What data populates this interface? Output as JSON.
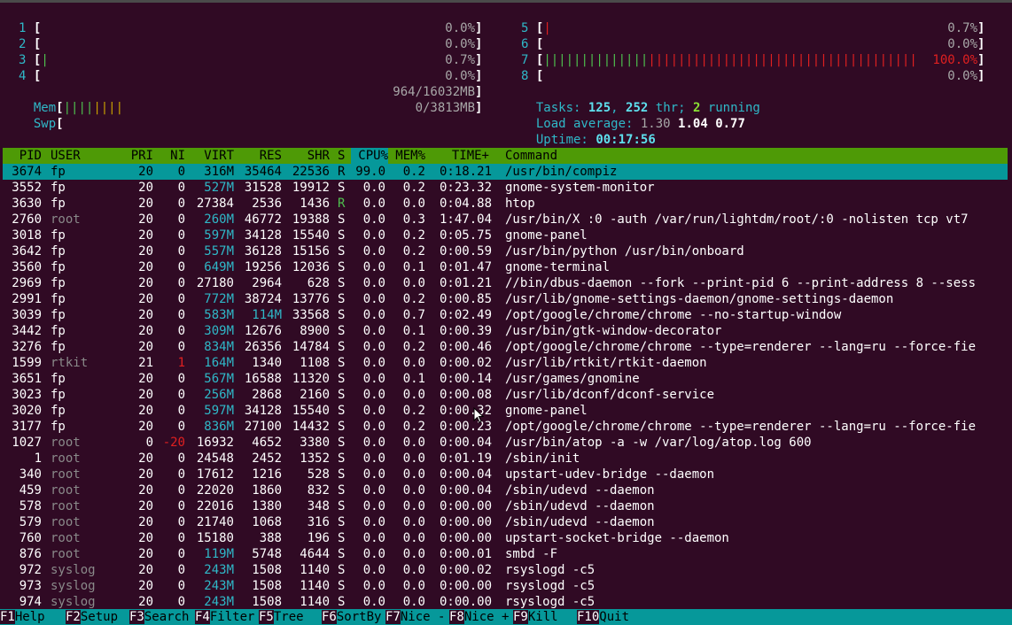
{
  "cpu_meters_left": [
    {
      "label": "1",
      "bars": "",
      "bar_color": "green",
      "value": "0.0%"
    },
    {
      "label": "2",
      "bars": "",
      "bar_color": "green",
      "value": "0.0%"
    },
    {
      "label": "3",
      "bars": "|",
      "bar_color": "green",
      "value": "0.7%"
    },
    {
      "label": "4",
      "bars": "",
      "bar_color": "green",
      "value": "0.0%"
    }
  ],
  "cpu_meters_right": [
    {
      "label": "5",
      "bars": "|",
      "bar_color": "red",
      "value": "0.7%"
    },
    {
      "label": "6",
      "bars": "",
      "bar_color": "green",
      "value": "0.0%"
    },
    {
      "label": "7",
      "bars_green": "||||||||||||||",
      "bars_red": "||||||||||||||||||||||||||||||||||||",
      "value": "100.0%"
    },
    {
      "label": "8",
      "bars": "",
      "bar_color": "green",
      "value": "0.0%"
    }
  ],
  "mem": {
    "label": "Mem",
    "bars_green": "||||",
    "bars_yellow": "||||",
    "value": "964/16032MB"
  },
  "swp": {
    "label": "Swp",
    "bars": "",
    "value": "0/3813MB"
  },
  "tasks": {
    "label": "Tasks:",
    "tasks": "125",
    "sep": ",",
    "threads": "252",
    "thr_label": "thr;",
    "running": "2",
    "running_label": "running"
  },
  "load": {
    "label": "Load average:",
    "l1": "1.30",
    "l5": "1.04",
    "l15": "0.77"
  },
  "uptime": {
    "label": "Uptime:",
    "value": "00:17:56"
  },
  "columns": [
    "PID",
    "USER",
    "PRI",
    "NI",
    "VIRT",
    "RES",
    "SHR",
    "S",
    "CPU%",
    "MEM%",
    "TIME+",
    "Command"
  ],
  "processes": [
    {
      "pid": "3674",
      "user": "fp",
      "pri": "20",
      "ni": "0",
      "virt": "316M",
      "res": "35464",
      "shr": "22536",
      "s": "R",
      "cpu": "99.0",
      "mem": "0.2",
      "time": "0:18.21",
      "cmd": "/usr/bin/compiz",
      "selected": true
    },
    {
      "pid": "3552",
      "user": "fp",
      "pri": "20",
      "ni": "0",
      "virt": "527M",
      "res": "31528",
      "shr": "19912",
      "s": "S",
      "cpu": "0.0",
      "mem": "0.2",
      "time": "0:23.32",
      "cmd": "gnome-system-monitor"
    },
    {
      "pid": "3630",
      "user": "fp",
      "pri": "20",
      "ni": "0",
      "virt": "27384",
      "res": "2536",
      "shr": "1436",
      "s": "R",
      "cpu": "0.0",
      "mem": "0.0",
      "time": "0:04.88",
      "cmd": "htop"
    },
    {
      "pid": "2760",
      "user": "root",
      "pri": "20",
      "ni": "0",
      "virt": "260M",
      "res": "46772",
      "shr": "19388",
      "s": "S",
      "cpu": "0.0",
      "mem": "0.3",
      "time": "1:47.04",
      "cmd": "/usr/bin/X :0 -auth /var/run/lightdm/root/:0 -nolisten tcp vt7"
    },
    {
      "pid": "3018",
      "user": "fp",
      "pri": "20",
      "ni": "0",
      "virt": "597M",
      "res": "34128",
      "shr": "15540",
      "s": "S",
      "cpu": "0.0",
      "mem": "0.2",
      "time": "0:05.75",
      "cmd": "gnome-panel"
    },
    {
      "pid": "3642",
      "user": "fp",
      "pri": "20",
      "ni": "0",
      "virt": "557M",
      "res": "36128",
      "shr": "15156",
      "s": "S",
      "cpu": "0.0",
      "mem": "0.2",
      "time": "0:00.59",
      "cmd": "/usr/bin/python /usr/bin/onboard"
    },
    {
      "pid": "3560",
      "user": "fp",
      "pri": "20",
      "ni": "0",
      "virt": "649M",
      "res": "19256",
      "shr": "12036",
      "s": "S",
      "cpu": "0.0",
      "mem": "0.1",
      "time": "0:01.47",
      "cmd": "gnome-terminal"
    },
    {
      "pid": "2969",
      "user": "fp",
      "pri": "20",
      "ni": "0",
      "virt": "27180",
      "res": "2964",
      "shr": "628",
      "s": "S",
      "cpu": "0.0",
      "mem": "0.0",
      "time": "0:01.21",
      "cmd": "//bin/dbus-daemon --fork --print-pid 6 --print-address 8 --sess"
    },
    {
      "pid": "2991",
      "user": "fp",
      "pri": "20",
      "ni": "0",
      "virt": "772M",
      "res": "38724",
      "shr": "13776",
      "s": "S",
      "cpu": "0.0",
      "mem": "0.2",
      "time": "0:00.85",
      "cmd": "/usr/lib/gnome-settings-daemon/gnome-settings-daemon"
    },
    {
      "pid": "3039",
      "user": "fp",
      "pri": "20",
      "ni": "0",
      "virt": "583M",
      "res": "114M",
      "shr": "33568",
      "s": "S",
      "cpu": "0.0",
      "mem": "0.7",
      "time": "0:02.49",
      "cmd": "/opt/google/chrome/chrome --no-startup-window"
    },
    {
      "pid": "3442",
      "user": "fp",
      "pri": "20",
      "ni": "0",
      "virt": "309M",
      "res": "12676",
      "shr": "8900",
      "s": "S",
      "cpu": "0.0",
      "mem": "0.1",
      "time": "0:00.39",
      "cmd": "/usr/bin/gtk-window-decorator"
    },
    {
      "pid": "3276",
      "user": "fp",
      "pri": "20",
      "ni": "0",
      "virt": "834M",
      "res": "26356",
      "shr": "14784",
      "s": "S",
      "cpu": "0.0",
      "mem": "0.2",
      "time": "0:00.46",
      "cmd": "/opt/google/chrome/chrome --type=renderer --lang=ru --force-fie"
    },
    {
      "pid": "1599",
      "user": "rtkit",
      "pri": "21",
      "ni": "1",
      "virt": "164M",
      "res": "1340",
      "shr": "1108",
      "s": "S",
      "cpu": "0.0",
      "mem": "0.0",
      "time": "0:00.02",
      "cmd": "/usr/lib/rtkit/rtkit-daemon"
    },
    {
      "pid": "3651",
      "user": "fp",
      "pri": "20",
      "ni": "0",
      "virt": "567M",
      "res": "16588",
      "shr": "11320",
      "s": "S",
      "cpu": "0.0",
      "mem": "0.1",
      "time": "0:00.14",
      "cmd": "/usr/games/gnomine"
    },
    {
      "pid": "3023",
      "user": "fp",
      "pri": "20",
      "ni": "0",
      "virt": "256M",
      "res": "2868",
      "shr": "2160",
      "s": "S",
      "cpu": "0.0",
      "mem": "0.0",
      "time": "0:00.08",
      "cmd": "/usr/lib/dconf/dconf-service"
    },
    {
      "pid": "3020",
      "user": "fp",
      "pri": "20",
      "ni": "0",
      "virt": "597M",
      "res": "34128",
      "shr": "15540",
      "s": "S",
      "cpu": "0.0",
      "mem": "0.2",
      "time": "0:00.32",
      "cmd": "gnome-panel"
    },
    {
      "pid": "3177",
      "user": "fp",
      "pri": "20",
      "ni": "0",
      "virt": "836M",
      "res": "27100",
      "shr": "14432",
      "s": "S",
      "cpu": "0.0",
      "mem": "0.2",
      "time": "0:00.23",
      "cmd": "/opt/google/chrome/chrome --type=renderer --lang=ru --force-fie"
    },
    {
      "pid": "1027",
      "user": "root",
      "pri": "0",
      "ni": "-20",
      "virt": "16932",
      "res": "4652",
      "shr": "3380",
      "s": "S",
      "cpu": "0.0",
      "mem": "0.0",
      "time": "0:00.04",
      "cmd": "/usr/bin/atop -a -w /var/log/atop.log 600"
    },
    {
      "pid": "1",
      "user": "root",
      "pri": "20",
      "ni": "0",
      "virt": "24548",
      "res": "2452",
      "shr": "1352",
      "s": "S",
      "cpu": "0.0",
      "mem": "0.0",
      "time": "0:01.19",
      "cmd": "/sbin/init"
    },
    {
      "pid": "340",
      "user": "root",
      "pri": "20",
      "ni": "0",
      "virt": "17612",
      "res": "1216",
      "shr": "528",
      "s": "S",
      "cpu": "0.0",
      "mem": "0.0",
      "time": "0:00.04",
      "cmd": "upstart-udev-bridge --daemon"
    },
    {
      "pid": "459",
      "user": "root",
      "pri": "20",
      "ni": "0",
      "virt": "22020",
      "res": "1860",
      "shr": "832",
      "s": "S",
      "cpu": "0.0",
      "mem": "0.0",
      "time": "0:00.04",
      "cmd": "/sbin/udevd --daemon"
    },
    {
      "pid": "578",
      "user": "root",
      "pri": "20",
      "ni": "0",
      "virt": "22016",
      "res": "1380",
      "shr": "348",
      "s": "S",
      "cpu": "0.0",
      "mem": "0.0",
      "time": "0:00.00",
      "cmd": "/sbin/udevd --daemon"
    },
    {
      "pid": "579",
      "user": "root",
      "pri": "20",
      "ni": "0",
      "virt": "21740",
      "res": "1068",
      "shr": "316",
      "s": "S",
      "cpu": "0.0",
      "mem": "0.0",
      "time": "0:00.00",
      "cmd": "/sbin/udevd --daemon"
    },
    {
      "pid": "760",
      "user": "root",
      "pri": "20",
      "ni": "0",
      "virt": "15180",
      "res": "388",
      "shr": "196",
      "s": "S",
      "cpu": "0.0",
      "mem": "0.0",
      "time": "0:00.00",
      "cmd": "upstart-socket-bridge --daemon"
    },
    {
      "pid": "876",
      "user": "root",
      "pri": "20",
      "ni": "0",
      "virt": "119M",
      "res": "5748",
      "shr": "4644",
      "s": "S",
      "cpu": "0.0",
      "mem": "0.0",
      "time": "0:00.01",
      "cmd": "smbd -F"
    },
    {
      "pid": "972",
      "user": "syslog",
      "pri": "20",
      "ni": "0",
      "virt": "243M",
      "res": "1508",
      "shr": "1140",
      "s": "S",
      "cpu": "0.0",
      "mem": "0.0",
      "time": "0:00.02",
      "cmd": "rsyslogd -c5"
    },
    {
      "pid": "973",
      "user": "syslog",
      "pri": "20",
      "ni": "0",
      "virt": "243M",
      "res": "1508",
      "shr": "1140",
      "s": "S",
      "cpu": "0.0",
      "mem": "0.0",
      "time": "0:00.00",
      "cmd": "rsyslogd -c5"
    },
    {
      "pid": "974",
      "user": "syslog",
      "pri": "20",
      "ni": "0",
      "virt": "243M",
      "res": "1508",
      "shr": "1140",
      "s": "S",
      "cpu": "0.0",
      "mem": "0.0",
      "time": "0:00.00",
      "cmd": "rsyslogd -c5"
    }
  ],
  "function_keys": [
    {
      "key": "F1",
      "label": "Help"
    },
    {
      "key": "F2",
      "label": "Setup"
    },
    {
      "key": "F3",
      "label": "Search"
    },
    {
      "key": "F4",
      "label": "Filter"
    },
    {
      "key": "F5",
      "label": "Tree"
    },
    {
      "key": "F6",
      "label": "SortBy"
    },
    {
      "key": "F7",
      "label": "Nice -"
    },
    {
      "key": "F8",
      "label": "Nice +"
    },
    {
      "key": "F9",
      "label": "Kill"
    },
    {
      "key": "F10",
      "label": "Quit"
    }
  ],
  "colors": {
    "bg": "#300a24",
    "header_green": "#4e9a06",
    "selection_cyan": "#06989a",
    "label_cyan": "#2fb8c8"
  },
  "icons": {
    "cursor": "mouse-pointer-icon"
  }
}
